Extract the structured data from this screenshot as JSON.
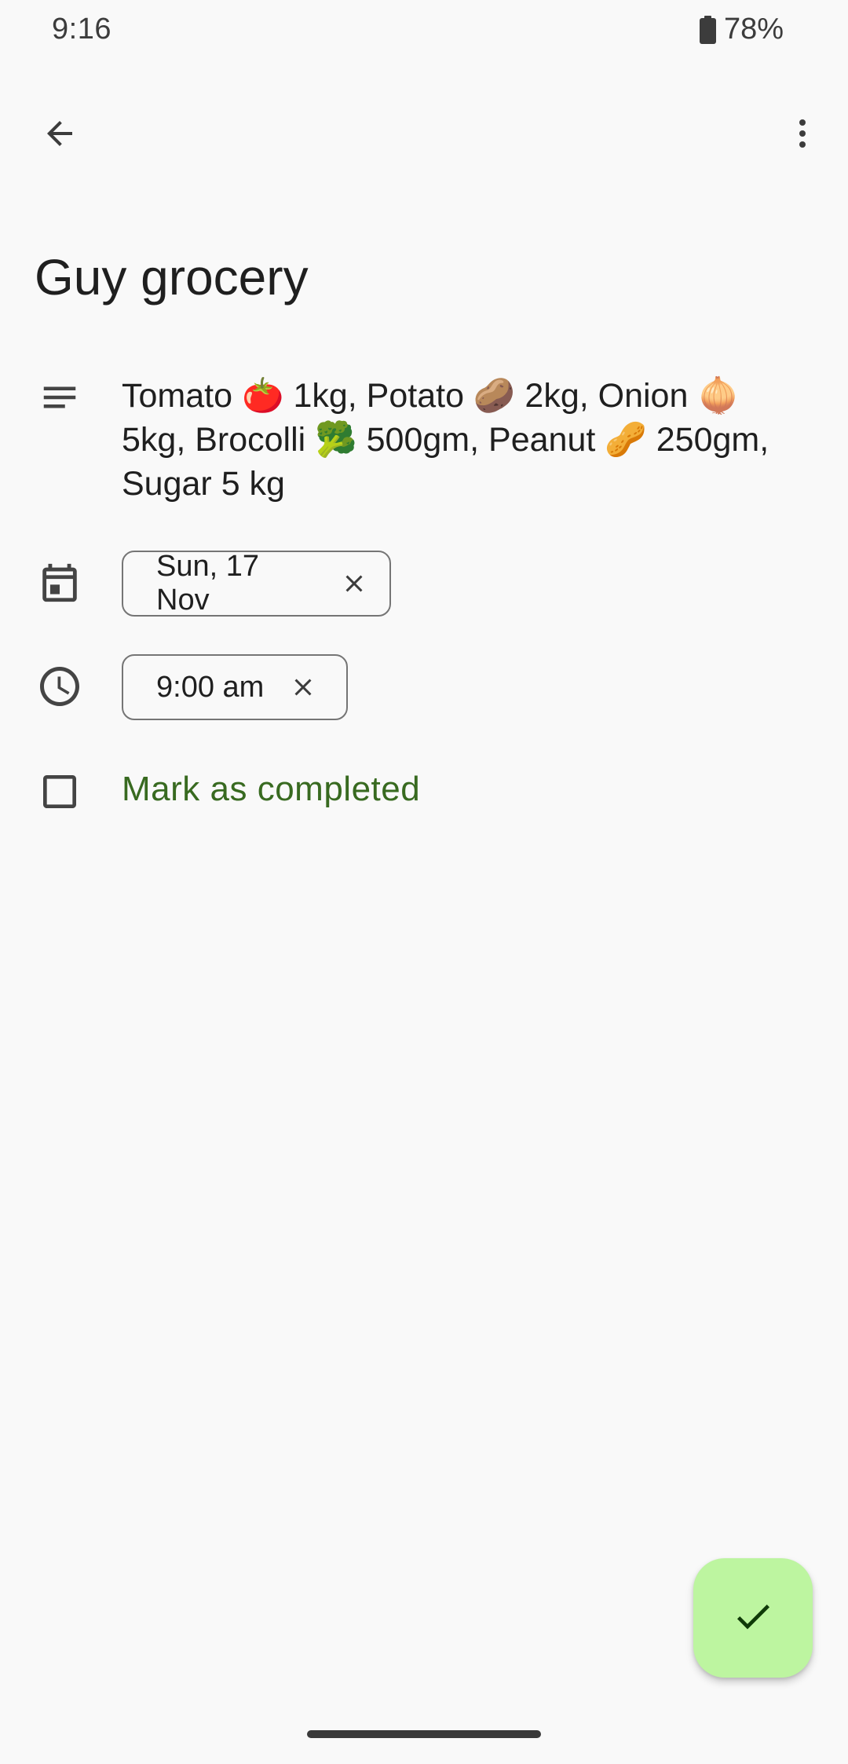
{
  "status_bar": {
    "time": "9:16",
    "battery": "78%"
  },
  "task": {
    "title": "Guy grocery",
    "notes": "Tomato 🍅 1kg, Potato 🥔 2kg, Onion 🧅 5kg, Brocolli 🥦 500gm, Peanut 🥜 250gm, Sugar 5 kg",
    "date_chip": "Sun, 17 Nov",
    "time_chip": "9:00 am",
    "complete_label": "Mark as completed"
  },
  "icons": {
    "back": "arrow-back-icon",
    "more": "more-vert-icon",
    "notes": "notes-icon",
    "date": "calendar-icon",
    "time": "clock-icon",
    "checkbox": "checkbox-outline-icon",
    "chip_close": "close-icon",
    "fab": "check-icon",
    "battery": "battery-icon"
  },
  "colors": {
    "background": "#f9f9f9",
    "accent_text": "#386a20",
    "fab_background": "#bdf5a0",
    "fab_icon": "#0f3a08"
  }
}
